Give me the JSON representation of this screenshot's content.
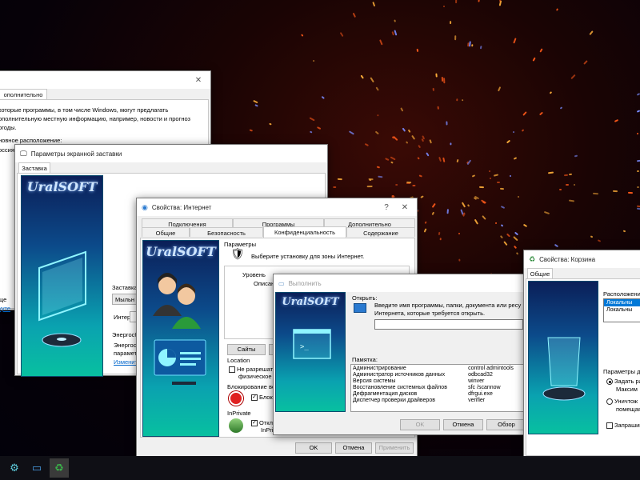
{
  "colors": {
    "accent": "#0078d7",
    "side_top": "#0b1f58",
    "side_bottom": "#08c0a0",
    "desktop_spark": "#ff5a1a"
  },
  "win_back": {
    "title": "",
    "tab": "ополнительно",
    "text1": "которые программы, в том числе Windows, могут предлагать",
    "text2": "ополнительную местную информацию, например, новости и прогноз",
    "text3": "огоды.",
    "text4": "новное расположение:",
    "text5": "оссия",
    "text6": "ще",
    "link1": "ууте"
  },
  "win_saver": {
    "title": "Параметры экранной заставки",
    "tab": "Заставка",
    "logo": "UralSOFT",
    "group_label": "Заставка",
    "combo_value": "Мыльн",
    "interval_label": "Интер",
    "energy_label": "Энергосб",
    "energy_text1": "Энергосбе",
    "energy_text2": "параметр",
    "energy_link": "Изменит"
  },
  "win_inet": {
    "title": "Свойства: Интернет",
    "help": "?",
    "close": "✕",
    "tabs_row1": [
      "Подключения",
      "Программы",
      "Дополнительно"
    ],
    "tabs_row2": [
      "Общие",
      "Безопасность",
      "Конфиденциальность",
      "Содержание"
    ],
    "logo": "UralSOFT",
    "params_label": "Параметры",
    "zone_text": "Выберите установку для зоны Интернет.",
    "level_label": "Уровень",
    "desc_label": "Описан",
    "sites_button": "Сайты",
    "location_label": "Location",
    "location_check": "Не разрешать",
    "location_check2": "физическое м",
    "popup_label": "Блокирование во",
    "popup_check": "Блоки",
    "inprivate_label": "InPrivate",
    "inprivate_check": "Откл",
    "inprivate_check2": "InPriv",
    "ok": "OK",
    "cancel": "Отмена",
    "apply": "Применить"
  },
  "win_run": {
    "title": "Выполнить",
    "logo": "UralSOFT",
    "open_label": "Открыть:",
    "desc1": "Введите имя программы, папки, документа или ресу",
    "desc2": "Интернета, которые требуется открыть.",
    "open_value": "",
    "memo_label": "Памятка:",
    "commands": [
      {
        "name": "Администрирование",
        "cmd": "control admintools"
      },
      {
        "name": "Администратор источников данных",
        "cmd": "odbcad32"
      },
      {
        "name": "Версия системы",
        "cmd": "winver"
      },
      {
        "name": "Восстановление системных файлов",
        "cmd": "sfc /scannow"
      },
      {
        "name": "Дефрагментация дисков",
        "cmd": "dfrgui.exe"
      },
      {
        "name": "Диспетчер проверки драйверов",
        "cmd": "verifier"
      }
    ],
    "ok": "OK",
    "cancel": "Отмена",
    "browse": "Обзор"
  },
  "win_bin": {
    "title": "Свойства: Корзина",
    "tab": "Общие",
    "location_label": "Расположени",
    "items": [
      "Локальны",
      "Локальны"
    ],
    "params_label": "Параметры д",
    "radio1": "Задать ра",
    "radio1b": "Максим",
    "radio2": "Уничтож",
    "radio2b": "помещая в",
    "confirm": "Запрашив"
  },
  "taskbar": {
    "icons": [
      "uralsoft-icon",
      "run-icon",
      "recycle-bin-icon"
    ]
  }
}
